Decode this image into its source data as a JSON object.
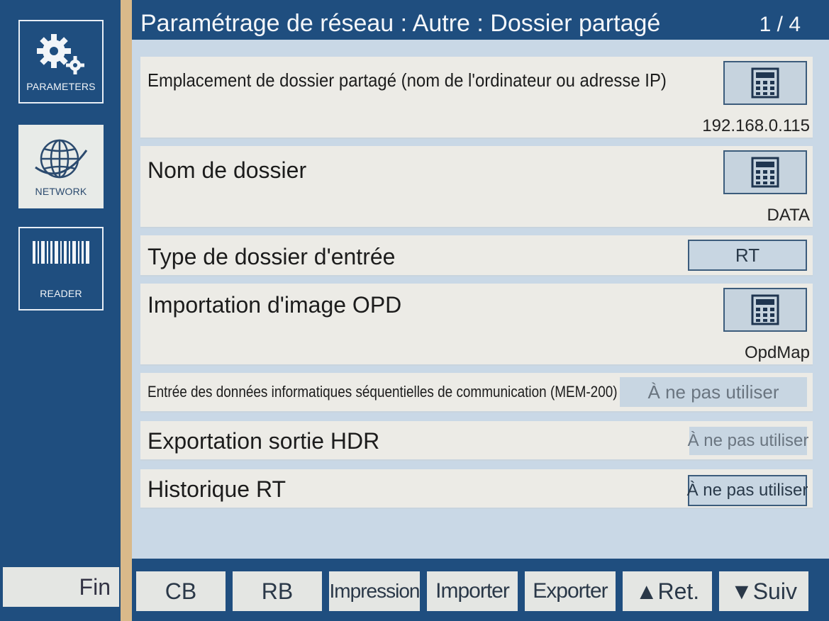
{
  "header": {
    "title": "Paramétrage de réseau : Autre : Dossier partagé",
    "page": "1 / 4"
  },
  "sidebar": {
    "items": [
      {
        "label": "PARAMETERS",
        "icon": "gears-icon",
        "selected": false
      },
      {
        "label": "NETWORK",
        "icon": "globe-icon",
        "selected": true
      },
      {
        "label": "READER",
        "icon": "barcode-icon",
        "selected": false
      }
    ],
    "fin_label": "Fin"
  },
  "rows": {
    "ip": {
      "label": "Emplacement de dossier partagé (nom de l'ordinateur ou adresse IP)",
      "value": "192.168.0.115",
      "icon": "keyboard-icon"
    },
    "folder": {
      "label": "Nom de dossier",
      "value": "DATA",
      "icon": "keyboard-icon"
    },
    "type": {
      "label": "Type de dossier d'entrée",
      "button": "RT"
    },
    "opd": {
      "label": "Importation d'image OPD",
      "value": "OpdMap",
      "icon": "keyboard-icon"
    },
    "mem": {
      "label": "Entrée des données informatiques séquentielles de communication (MEM-200)",
      "button": "À ne pas utiliser"
    },
    "hdr": {
      "label": "Exportation sortie HDR",
      "button": "À ne pas utiliser"
    },
    "rt": {
      "label": "Historique RT",
      "button": "À ne pas utiliser"
    }
  },
  "footer": {
    "cb": "CB",
    "rb": "RB",
    "impression": "Impression",
    "importer": "Importer",
    "exporter": "Exporter",
    "ret": "▲Ret.",
    "suiv": "▼Suiv"
  },
  "colors": {
    "panel_blue": "#1f4e7f",
    "divider_tan": "#d9b98a",
    "row_bg": "#ecebe6",
    "content_bg": "#c9d8e6"
  }
}
